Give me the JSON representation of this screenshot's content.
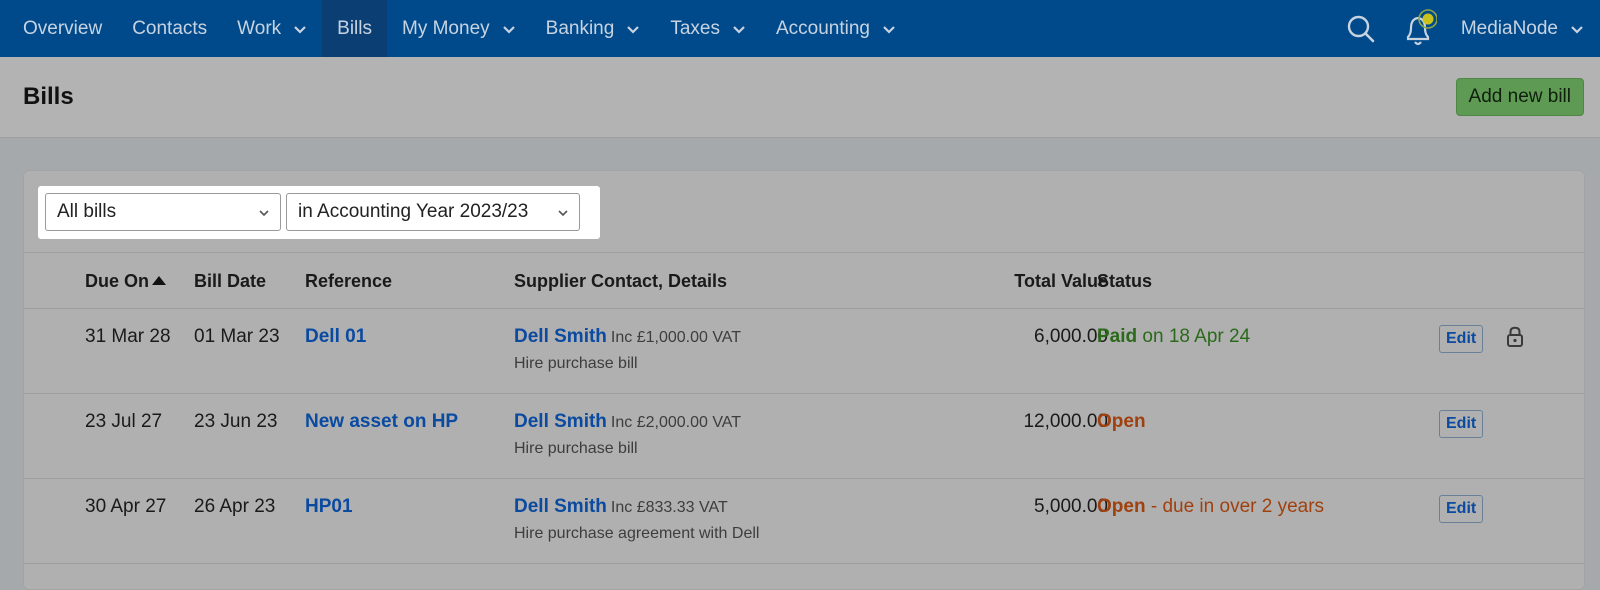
{
  "nav": {
    "items": [
      {
        "label": "Overview",
        "dropdown": false,
        "active": false
      },
      {
        "label": "Contacts",
        "dropdown": false,
        "active": false
      },
      {
        "label": "Work",
        "dropdown": true,
        "active": false
      },
      {
        "label": "Bills",
        "dropdown": false,
        "active": true
      },
      {
        "label": "My Money",
        "dropdown": true,
        "active": false
      },
      {
        "label": "Banking",
        "dropdown": true,
        "active": false
      },
      {
        "label": "Taxes",
        "dropdown": true,
        "active": false
      },
      {
        "label": "Accounting",
        "dropdown": true,
        "active": false
      }
    ],
    "user": "MediaNode",
    "icons": [
      "search-icon",
      "bell-icon",
      "chevron-down-icon"
    ]
  },
  "page": {
    "title": "Bills",
    "add_button": "Add new bill"
  },
  "filters": {
    "type_selected": "All bills",
    "period_selected": "in Accounting Year 2023/23"
  },
  "table": {
    "headers": {
      "due_on": "Due On",
      "bill_date": "Bill Date",
      "reference": "Reference",
      "supplier": "Supplier Contact, Details",
      "total": "Total Value",
      "status": "Status"
    },
    "sort": {
      "column": "due_on",
      "direction": "ascending"
    },
    "edit_label": "Edit",
    "rows": [
      {
        "due_on": "31 Mar 28",
        "bill_date": "01 Mar 23",
        "reference": "Dell 01",
        "supplier": "Dell Smith",
        "vat": "Inc £1,000.00 VAT",
        "detail": "Hire purchase bill",
        "total": "6,000.00",
        "status": "Paid",
        "status_note": "on 18 Apr 24",
        "locked": true
      },
      {
        "due_on": "23 Jul 27",
        "bill_date": "23 Jun 23",
        "reference": "New asset on HP",
        "supplier": "Dell Smith",
        "vat": "Inc £2,000.00 VAT",
        "detail": "Hire purchase bill",
        "total": "12,000.00",
        "status": "Open",
        "status_note": "",
        "locked": false
      },
      {
        "due_on": "30 Apr 27",
        "bill_date": "26 Apr 23",
        "reference": "HP01",
        "supplier": "Dell Smith",
        "vat": "Inc £833.33 VAT",
        "detail": "Hire purchase agreement with Dell",
        "total": "5,000.00",
        "status": "Open",
        "status_note": "- due in over 2 years",
        "locked": false
      }
    ]
  },
  "colors": {
    "nav_bg": "#004a8b",
    "add_button": "#5f9a55",
    "link": "#0a4aa0",
    "paid": "#2a6a1a",
    "open": "#a0400e"
  }
}
